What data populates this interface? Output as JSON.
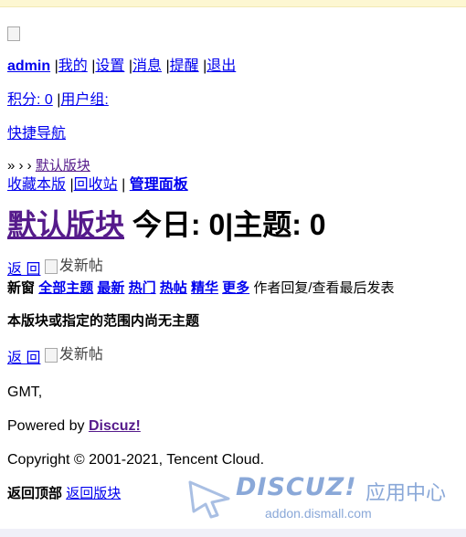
{
  "header": {
    "username": "admin",
    "links": [
      "我的",
      "设置",
      "消息",
      "提醒",
      "退出"
    ],
    "points": "积分: 0",
    "usergroup": "用户组:",
    "quick_nav": "快捷导航"
  },
  "breadcrumb": {
    "prefix": "» › › ",
    "current": "默认版块"
  },
  "forum_actions": {
    "favorite": "收藏本版",
    "recycle": "回收站",
    "admin_panel": "管理面板"
  },
  "forum": {
    "name": "默认版块",
    "stats": " 今日: 0|主题: 0"
  },
  "toolbar": {
    "back": "返 回",
    "new_post_alt": "发新帖"
  },
  "filters": {
    "new_window": "新窗",
    "items": [
      "全部主题",
      "最新",
      "热门",
      "热帖",
      "精华",
      "更多"
    ],
    "tail": "作者回复/查看最后发表"
  },
  "empty_message": "本版块或指定的范围内尚无主题",
  "footer": {
    "timezone": "GMT,",
    "powered_by": "Powered by ",
    "powered_link": "Discuz!",
    "copyright": "Copyright © 2001-2021, Tencent Cloud.",
    "back_top": "返回顶部",
    "back_forum": "返回版块"
  },
  "watermark": {
    "brand": "DISCUZ!",
    "cn": "应用中心",
    "url": "addon.dismall.com"
  },
  "colors": {
    "link": "#0000ee",
    "visited": "#551a8b",
    "watermark": "#8aa8d8",
    "topbar": "#fdf7d2"
  }
}
